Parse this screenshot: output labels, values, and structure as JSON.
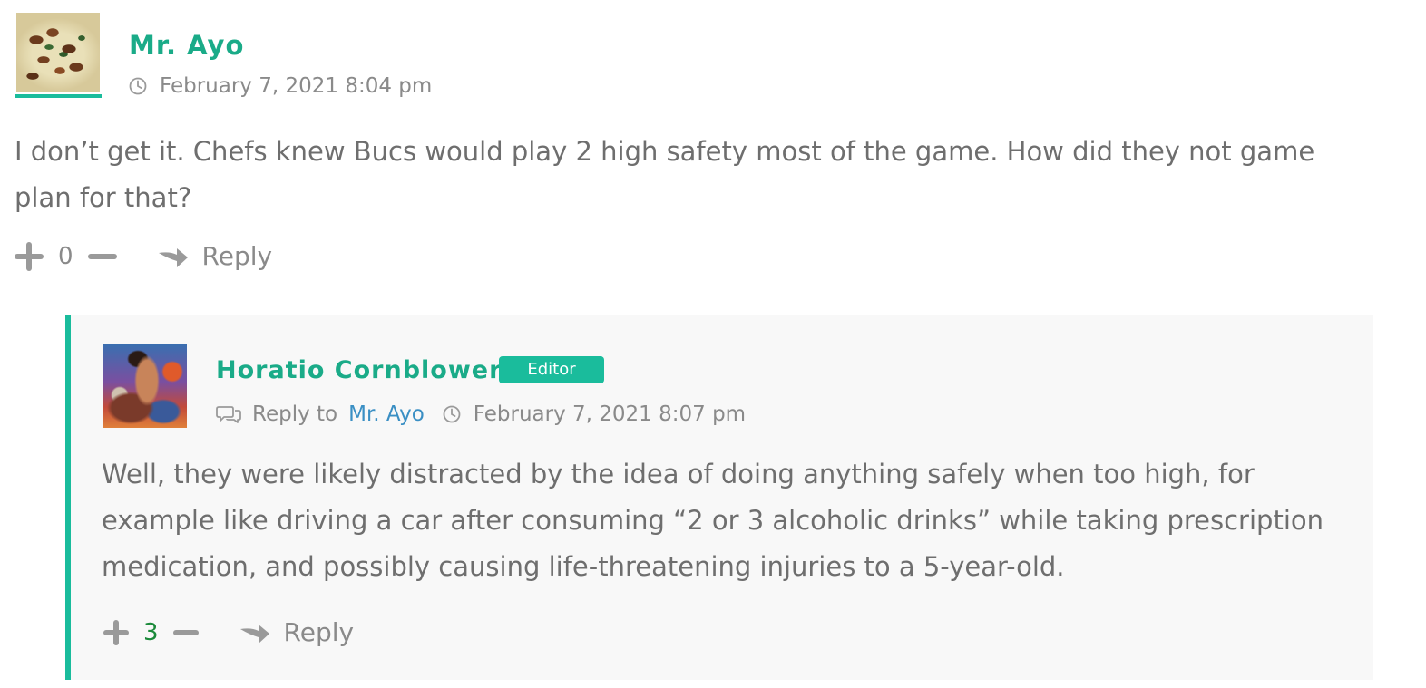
{
  "comments": [
    {
      "author": "Mr. Ayo",
      "date": "February 7, 2021 8:04 pm",
      "text": "I don’t get it. Chefs knew Bucs would play 2 high safety most of the game. How did they not game plan for that?",
      "votes": "0",
      "reply_label": "Reply",
      "avatar_icon": "food-photo-avatar"
    },
    {
      "author": "Horatio Cornblower",
      "badge": "Editor",
      "reply_to_label": "Reply to",
      "reply_to_name": "Mr. Ayo",
      "date": "February 7, 2021 8:07 pm",
      "text": "Well, they were likely distracted by the idea of doing anything safely when too high, for example like driving a car after consuming “2 or 3 alcoholic drinks” while taking prescription medication, and possibly causing life-threatening injuries to a 5-year-old.",
      "votes": "3",
      "reply_label": "Reply",
      "avatar_icon": "illustrated-poster-avatar"
    }
  ],
  "colors": {
    "accent": "#1abc9c",
    "author_name": "#1aab88",
    "link": "#3a8fc4",
    "positive_votes": "#1b8a3a",
    "reply_background": "#f8f8f8"
  },
  "icons": {
    "clock": "clock-icon",
    "vote_up": "plus-icon",
    "vote_down": "minus-icon",
    "reply": "reply-arrow-icon",
    "reply_to": "chat-bubbles-icon"
  }
}
